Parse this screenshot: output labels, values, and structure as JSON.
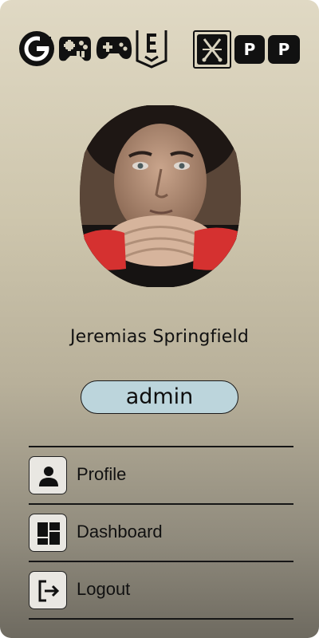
{
  "top_icons": [
    {
      "name": "g-logo-icon"
    },
    {
      "name": "gamepad-retro-icon"
    },
    {
      "name": "gamepad-icon"
    },
    {
      "name": "e-badge-icon"
    },
    {
      "name": "xbox-style-x-icon"
    },
    {
      "name": "p-letter-icon"
    },
    {
      "name": "p-letter-icon"
    }
  ],
  "top_icon_letters": {
    "p1": "P",
    "p2": "P"
  },
  "user": {
    "name": "Jeremias Springfield",
    "role": "admin"
  },
  "menu": {
    "items": [
      {
        "label": "Profile",
        "icon": "person-icon"
      },
      {
        "label": "Dashboard",
        "icon": "dashboard-icon"
      },
      {
        "label": "Logout",
        "icon": "logout-icon"
      }
    ]
  },
  "colors": {
    "role_badge_bg": "#bcd5dc",
    "panel_top": "#e0d9c4",
    "panel_bottom": "#6e6a60"
  }
}
